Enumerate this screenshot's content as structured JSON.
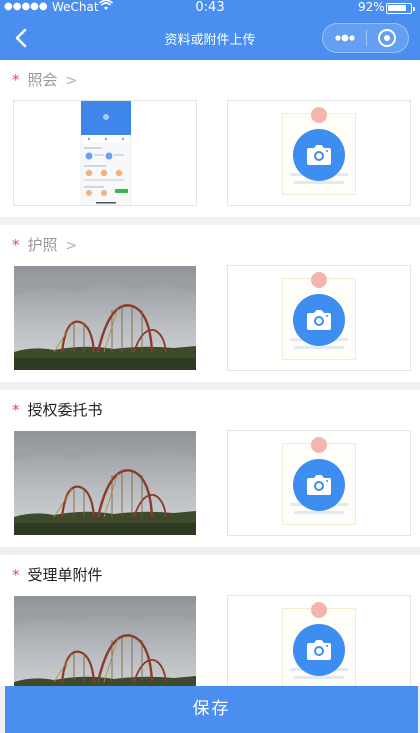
{
  "status_bar": {
    "signal": "●●●●●",
    "carrier": "WeChat",
    "time": "0:43",
    "battery_pct": "92%",
    "battery_level": 0.92
  },
  "nav": {
    "title": "资料或附件上传",
    "back_icon": "chevron-left-icon",
    "more_icon": "more-dots-icon",
    "close_icon": "target-circle-icon"
  },
  "sections": [
    {
      "label": "照会",
      "required": "*",
      "has_chevron": true,
      "thumbnail": "app-screenshot"
    },
    {
      "label": "护照",
      "required": "*",
      "has_chevron": true,
      "thumbnail": "roller-coaster-photo"
    },
    {
      "label": "授权委托书",
      "required": "*",
      "has_chevron": false,
      "thumbnail": "roller-coaster-photo"
    },
    {
      "label": "受理单附件",
      "required": "*",
      "has_chevron": false,
      "thumbnail": "roller-coaster-photo"
    }
  ],
  "chevron_glyph": ">",
  "save_label": "保存",
  "colors": {
    "primary": "#4a8ff0",
    "camera": "#3d8ef0",
    "required": "#e54a4a"
  }
}
